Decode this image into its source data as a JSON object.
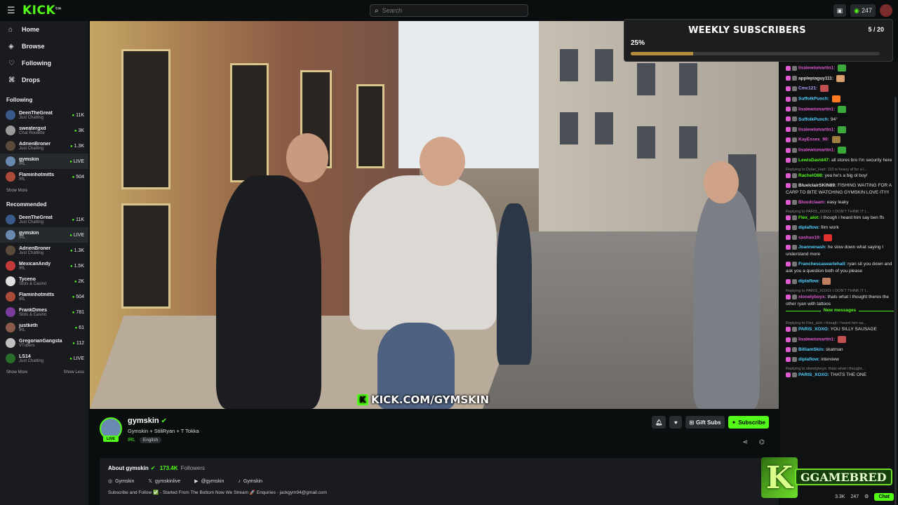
{
  "topbar": {
    "logo": "KICK",
    "logo_sup": "tm",
    "search_placeholder": "Search",
    "viewer_count": "247"
  },
  "sidebar": {
    "nav": [
      {
        "label": "Home",
        "icon": "home-icon",
        "glyph": "⌂"
      },
      {
        "label": "Browse",
        "icon": "browse-icon",
        "glyph": "◈"
      },
      {
        "label": "Following",
        "icon": "heart-icon",
        "glyph": "♡"
      },
      {
        "label": "Drops",
        "icon": "gift-icon",
        "glyph": "⌘"
      }
    ],
    "following_title": "Following",
    "following": [
      {
        "name": "DeenTheGreat",
        "category": "Just Chatting",
        "viewers": "11K",
        "color": "#3a5a8a"
      },
      {
        "name": "sweatergxd",
        "category": "Chat Roulette",
        "viewers": "3K",
        "color": "#9a9a9a"
      },
      {
        "name": "AdrienBroner",
        "category": "Just Chatting",
        "viewers": "1.3K",
        "color": "#5a4a3a"
      },
      {
        "name": "gymskin",
        "category": "IRL",
        "viewers": "LIVE",
        "color": "#6a8ab1"
      },
      {
        "name": "Flaminhotmitts",
        "category": "IRL",
        "viewers": "504",
        "color": "#aa4a3a"
      }
    ],
    "show_more_1": "Show More",
    "recommended_title": "Recommended",
    "recommended": [
      {
        "name": "DeenTheGreat",
        "category": "Just Chatting",
        "viewers": "11K",
        "color": "#3a5a8a"
      },
      {
        "name": "gymskin",
        "category": "IRL",
        "viewers": "LIVE",
        "color": "#6a8ab1"
      },
      {
        "name": "AdrienBroner",
        "category": "Just Chatting",
        "viewers": "1.3K",
        "color": "#5a4a3a"
      },
      {
        "name": "MexicanAndy",
        "category": "IRL",
        "viewers": "1.5K",
        "color": "#c43a3a"
      },
      {
        "name": "Tyceno",
        "category": "Slots & Casino",
        "viewers": "2K",
        "color": "#e0e0e0"
      },
      {
        "name": "Flaminhotmitts",
        "category": "IRL",
        "viewers": "504",
        "color": "#aa4a3a"
      },
      {
        "name": "FrankDimes",
        "category": "Slots & Casino",
        "viewers": "781",
        "color": "#7a3a9a"
      },
      {
        "name": "justketh",
        "category": "IRL",
        "viewers": "61",
        "color": "#8a5a4a"
      },
      {
        "name": "GregorianGangsta",
        "category": "VTubers",
        "viewers": "112",
        "color": "#c0c0c0"
      },
      {
        "name": "LS14",
        "category": "Just Chatting",
        "viewers": "LIVE",
        "color": "#2a6a2a"
      }
    ],
    "show_more_2": "Show More",
    "show_less": "Show Less"
  },
  "video": {
    "watermark": "KICK.COM/GYMSKIN",
    "watermark_k": "K"
  },
  "goal": {
    "title": "WEEKLY SUBSCRIBERS",
    "count": "5 / 20",
    "percent_label": "25%",
    "progress": 0.25
  },
  "chat": {
    "messages": [
      {
        "user": "lisalewismartin1:",
        "text": "",
        "color": "#e05ad0",
        "emote": "#3aa83a"
      },
      {
        "user": "applepiaguy111:",
        "text": "",
        "color": "#e0e0e0",
        "emote": "#d9a070"
      },
      {
        "user": "Cmc121:",
        "text": "",
        "color": "#b0a0ff",
        "emote": "#c05050"
      },
      {
        "user": "SuffolkPunch:",
        "text": "",
        "color": "#53d0ff",
        "emote": "#ff7a20"
      },
      {
        "user": "lisalewismartin1:",
        "text": "",
        "color": "#e05ad0",
        "emote": "#3aa83a"
      },
      {
        "user": "SuffolkPunch:",
        "text": "94°",
        "color": "#53d0ff",
        "emote": ""
      },
      {
        "user": "lisalewismartin1:",
        "text": "",
        "color": "#e05ad0",
        "emote": "#3aa83a"
      },
      {
        "user": "KayEssex_90:",
        "text": "",
        "color": "#e05ad0",
        "emote": "#a08040"
      },
      {
        "user": "lisalewismartin1:",
        "text": "",
        "color": "#e05ad0",
        "emote": "#3aa83a"
      },
      {
        "user": "LewisDavid47:",
        "text": "all stores bro I'm security here",
        "color": "#53fc18",
        "emote": ""
      },
      {
        "reply": "Replying to Dylan_Hart: 110 is heavy af for a l...",
        "user": "RachelO88:",
        "text": "yea he's a big ol boy!",
        "color": "#53fc18",
        "emote": ""
      },
      {
        "user": "BluelclairSKIN89:",
        "text": "FISHING WAITING FOR A CARP TO BITE WATCHING GYMSKIN LOVE IT!!!!",
        "color": "#e0e0e0",
        "emote": ""
      },
      {
        "user": "Bluudclaam:",
        "text": "easy leaky",
        "color": "#e05ad0",
        "emote": ""
      },
      {
        "reply": "Replying to PARIS_XOXO: I DON'T THINK IT I...",
        "user": "Flex_alot:",
        "text": "i though i heard him say ben ffs",
        "color": "#53fc18",
        "emote": ""
      },
      {
        "user": "diplaflow:",
        "text": "film work",
        "color": "#53d0ff",
        "emote": ""
      },
      {
        "user": "sashxo10:",
        "text": "",
        "color": "#e05ad0",
        "emote": "#e03030"
      },
      {
        "user": "Joannenash:",
        "text": "he slow down what saying I understand more",
        "color": "#53d0ff",
        "emote": ""
      },
      {
        "user": "Franchescasearlehall:",
        "text": "ryan sit you down and ask you a question both of you please",
        "color": "#53d0ff",
        "emote": ""
      },
      {
        "user": "diplaflow:",
        "text": "",
        "color": "#53d0ff",
        "emote": "#c08060"
      },
      {
        "reply": "Replying to PARIS_XOXO: I DON'T THINK IT I...",
        "user": "xlonelyboyx:",
        "text": "thats what I thought theres the other ryan with tattoos",
        "color": "#e05ad0",
        "emote": ""
      }
    ],
    "new_messages": "New messages",
    "messages_after": [
      {
        "reply": "Replying to Flex_alot: i though i heard him sa...",
        "user": "PARIS_XOXO:",
        "text": "YOU SILLY SAUSAGE",
        "color": "#53d0ff",
        "emote": ""
      },
      {
        "user": "lisalewismartin1:",
        "text": "",
        "color": "#e05ad0",
        "emote": "#c05050"
      },
      {
        "user": "BilliamSkin:",
        "text": "skatman",
        "color": "#53d0ff",
        "emote": ""
      },
      {
        "user": "diplaflow:",
        "text": "interview",
        "color": "#53d0ff",
        "emote": ""
      },
      {
        "reply": "Replying to xlonelyboyx: thats what i thought...",
        "user": "PARIS_XOXO:",
        "text": "THATS THE ONE",
        "color": "#53d0ff",
        "emote": ""
      }
    ],
    "footer_count_1": "3.3K",
    "footer_count_2": "247",
    "chat_button": "Chat"
  },
  "stream": {
    "name": "gymskin",
    "live_badge": "LIVE",
    "title": "Gymskin + StiliRyan + T Tokka",
    "category": "IRL",
    "language": "English",
    "gift_subs": "Gift Subs",
    "subscribe": "Subscribe"
  },
  "about": {
    "label": "About gymskin",
    "followers_count": "173.4K",
    "followers_label": "Followers",
    "socials": [
      {
        "icon": "instagram-icon",
        "glyph": "◎",
        "label": "Gymskin"
      },
      {
        "icon": "x-icon",
        "glyph": "𝕏",
        "label": "gymskinlive"
      },
      {
        "icon": "youtube-icon",
        "glyph": "▶",
        "label": "@gymskin"
      },
      {
        "icon": "tiktok-icon",
        "glyph": "♪",
        "label": "Gymskin"
      }
    ],
    "bio": "Subscribe and Follow ✅ - Started From The Bottom Now We Stream 🚀 Enquiries - jackgym94@gmail.com"
  },
  "overlay": {
    "k": "K",
    "brand": "GGAMEBRED"
  },
  "colors": {
    "accent": "#53fc18",
    "background": "#0b0e0f",
    "sidebar": "#191b1f",
    "goal_fill": "#b38d3a"
  }
}
